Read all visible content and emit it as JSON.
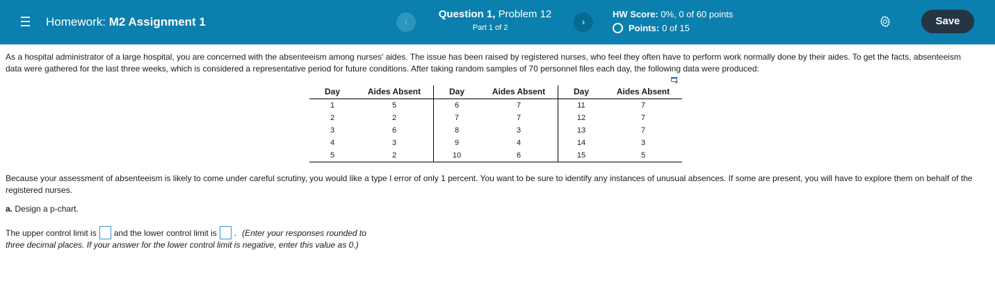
{
  "header": {
    "menu_icon": "hamburger-icon",
    "hw_prefix": "Homework:",
    "hw_name": "M2 Assignment 1",
    "question_label": "Question 1,",
    "question_problem": "Problem 12",
    "part": "Part 1 of 2",
    "prev_icon": "‹",
    "next_icon": "›",
    "score_label": "HW Score:",
    "score_value": "0%, 0 of 60 points",
    "points_label": "Points:",
    "points_value": "0 of 15",
    "settings_icon": "gear-icon",
    "save_label": "Save",
    "colors": {
      "bar": "#0b7fad",
      "save": "#253545"
    }
  },
  "problem": {
    "intro": "As a hospital administrator of a large hospital, you are concerned with the absenteeism among nurses' aides. The issue has been raised by registered nurses, who feel they often have to perform work normally done by their aides. To get the facts, absenteeism data were gathered for the last three weeks, which is considered a representative period for future conditions. After taking random samples of 70 personnel files each day, the following data were produced:",
    "table": {
      "headers": [
        "Day",
        "Aides Absent",
        "Day",
        "Aides Absent",
        "Day",
        "Aides Absent"
      ],
      "rows": [
        [
          "1",
          "5",
          "6",
          "7",
          "11",
          "7"
        ],
        [
          "2",
          "2",
          "7",
          "7",
          "12",
          "7"
        ],
        [
          "3",
          "6",
          "8",
          "3",
          "13",
          "7"
        ],
        [
          "4",
          "3",
          "9",
          "4",
          "14",
          "3"
        ],
        [
          "5",
          "2",
          "10",
          "6",
          "15",
          "5"
        ]
      ]
    },
    "followup": "Because your assessment of absenteeism is likely to come under careful scrutiny, you would like a type I error of only 1 percent. You want to be sure to identify any instances of unusual absences. If some are present, you will have to explore them on behalf of the registered nurses.",
    "part_a_label": "a.",
    "part_a_text": "Design a p-chart.",
    "answer_pre": "The upper control limit is",
    "answer_mid": "and the lower control limit is",
    "answer_post": ".",
    "instruction_1": "(Enter your responses rounded to",
    "instruction_2": "three decimal places. If your answer for the lower control limit is negative, enter this value as 0.)"
  }
}
